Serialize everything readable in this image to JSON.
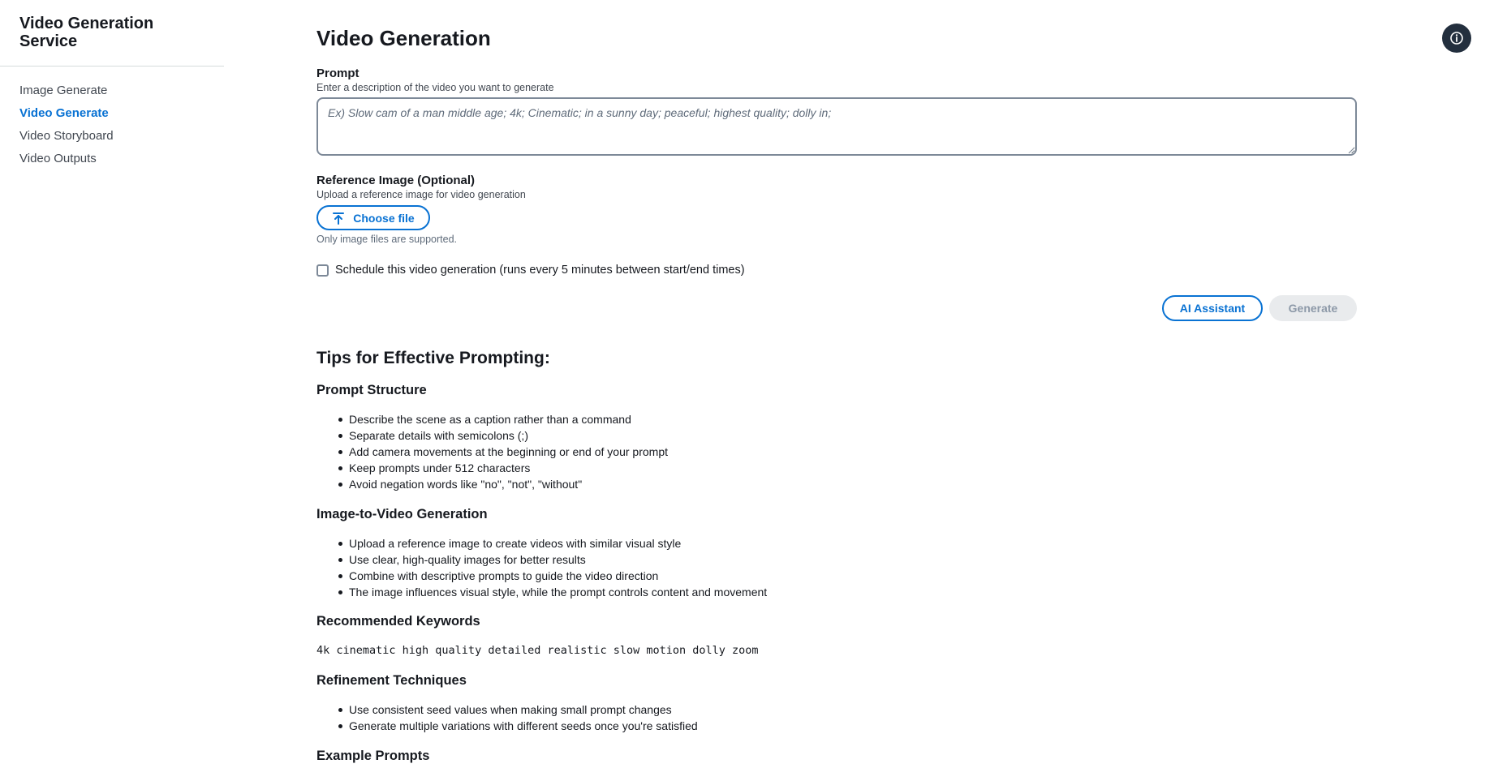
{
  "sidebar": {
    "app_title": "Video Generation Service",
    "items": [
      {
        "label": "Image Generate"
      },
      {
        "label": "Video Generate"
      },
      {
        "label": "Video Storyboard"
      },
      {
        "label": "Video Outputs"
      }
    ],
    "active_index": 1
  },
  "header": {
    "page_title": "Video Generation",
    "info_icon": "info-icon"
  },
  "form": {
    "prompt_label": "Prompt",
    "prompt_description": "Enter a description of the video you want to generate",
    "prompt_value": "",
    "prompt_placeholder": "Ex) Slow cam of a man middle age; 4k; Cinematic; in a sunny day; peaceful; highest quality; dolly in;",
    "reference_label": "Reference Image (Optional)",
    "reference_description": "Upload a reference image for video generation",
    "choose_file_label": "Choose file",
    "upload_icon": "upload-icon",
    "file_hint": "Only image files are supported.",
    "schedule_label": "Schedule this video generation (runs every 5 minutes between start/end times)",
    "schedule_checked": false,
    "ai_assistant_label": "AI Assistant",
    "generate_label": "Generate",
    "generate_disabled": true
  },
  "tips": {
    "title": "Tips for Effective Prompting:",
    "sections": [
      {
        "title": "Prompt Structure",
        "items": [
          "Describe the scene as a caption rather than a command",
          "Separate details with semicolons (;)",
          "Add camera movements at the beginning or end of your prompt",
          "Keep prompts under 512 characters",
          "Avoid negation words like \"no\", \"not\", \"without\""
        ]
      },
      {
        "title": "Image-to-Video Generation",
        "items": [
          "Upload a reference image to create videos with similar visual style",
          "Use clear, high-quality images for better results",
          "Combine with descriptive prompts to guide the video direction",
          "The image influences visual style, while the prompt controls content and movement"
        ]
      },
      {
        "title": "Recommended Keywords",
        "keywords": "4k cinematic high quality detailed realistic slow motion dolly zoom"
      },
      {
        "title": "Refinement Techniques",
        "items": [
          "Use consistent seed values when making small prompt changes",
          "Generate multiple variations with different seeds once you're satisfied"
        ]
      },
      {
        "title": "Example Prompts"
      }
    ]
  },
  "colors": {
    "accent": "#0972d3",
    "dark": "#232f3e",
    "disabled_bg": "#e9ebed"
  }
}
